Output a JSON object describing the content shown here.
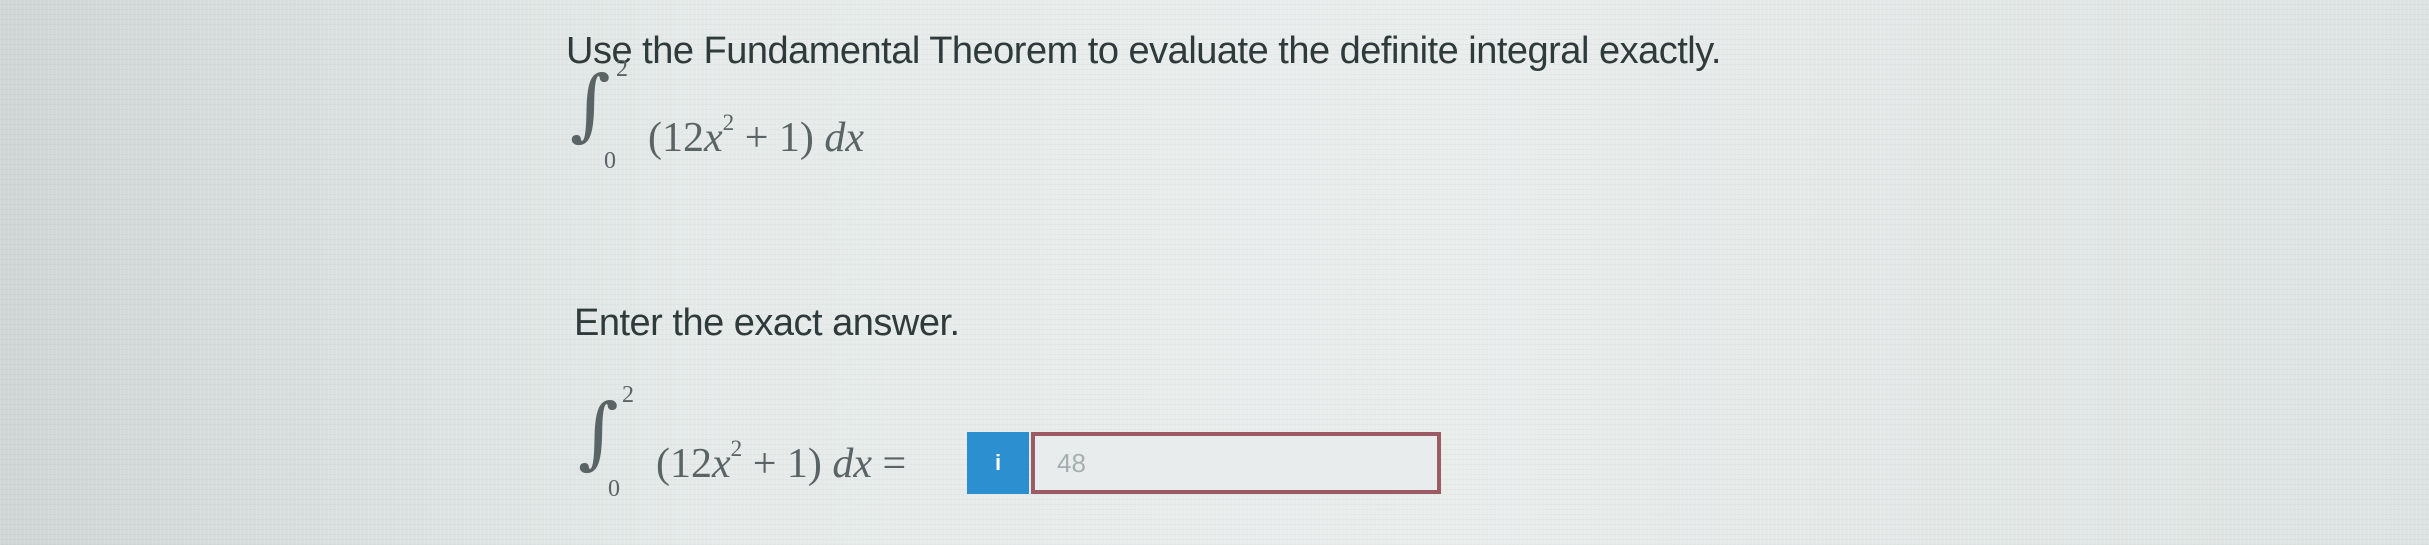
{
  "question": {
    "instruction": "Use the Fundamental Theorem to evaluate the definite integral exactly.",
    "integral": {
      "symbol": "∫",
      "upper_limit": "2",
      "lower_limit": "0",
      "integrand_open": "(12",
      "variable": "x",
      "exponent": "2",
      "integrand_rest": " + 1) ",
      "differential": "dx"
    }
  },
  "answer": {
    "prompt": "Enter the exact answer.",
    "integral": {
      "symbol": "∫",
      "upper_limit": "2",
      "lower_limit": "0",
      "integrand_open": "(12",
      "variable": "x",
      "exponent": "2",
      "integrand_rest": " + 1) ",
      "differential": "dx",
      "equals": " ="
    },
    "hint_badge": "i",
    "input_value": "48"
  },
  "colors": {
    "badge": "#2b8fd0",
    "input_border": "#9b5a64"
  }
}
